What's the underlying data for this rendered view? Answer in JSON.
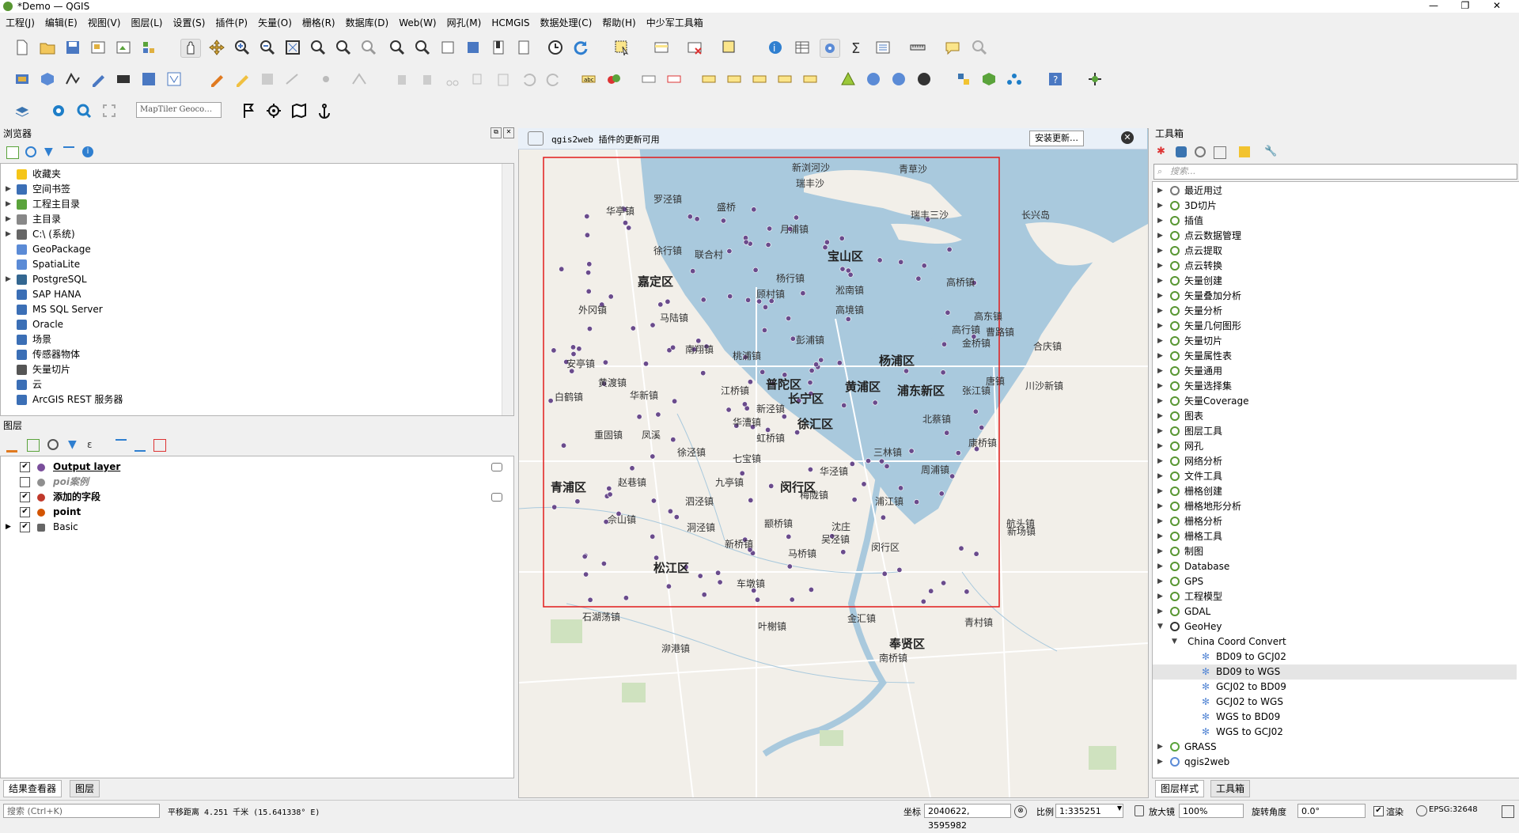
{
  "window": {
    "title": "*Demo — QGIS",
    "min": "—",
    "max": "❐",
    "close": "✕"
  },
  "menu": [
    "工程(J)",
    "编辑(E)",
    "视图(V)",
    "图层(L)",
    "设置(S)",
    "插件(P)",
    "矢量(O)",
    "栅格(R)",
    "数据库(D)",
    "Web(W)",
    "网孔(M)",
    "HCMGIS",
    "数据处理(C)",
    "帮助(H)",
    "中少军工具箱"
  ],
  "search_bar": {
    "geocoder_placeholder": "MapTiler Geoco…"
  },
  "browser": {
    "title": "浏览器",
    "items": [
      {
        "label": "收藏夹",
        "icon": "star-icon",
        "color": "#f5c518",
        "expandable": false
      },
      {
        "label": "空间书签",
        "icon": "bookmark-icon",
        "color": "#3b6fb6",
        "expandable": true
      },
      {
        "label": "工程主目录",
        "icon": "project-home-icon",
        "color": "#5aa33b",
        "expandable": true
      },
      {
        "label": "主目录",
        "icon": "home-icon",
        "color": "#888888",
        "expandable": true
      },
      {
        "label": "C:\\ (系统)",
        "icon": "drive-icon",
        "color": "#666666",
        "expandable": true
      },
      {
        "label": "GeoPackage",
        "icon": "geopackage-icon",
        "color": "#5b8bd6",
        "expandable": false
      },
      {
        "label": "SpatiaLite",
        "icon": "spatialite-icon",
        "color": "#5b8bd6",
        "expandable": false
      },
      {
        "label": "PostgreSQL",
        "icon": "postgresql-icon",
        "color": "#336791",
        "expandable": true
      },
      {
        "label": "SAP HANA",
        "icon": "sap-hana-icon",
        "color": "#3b6fb6",
        "expandable": false
      },
      {
        "label": "MS SQL Server",
        "icon": "mssql-icon",
        "color": "#3b6fb6",
        "expandable": false
      },
      {
        "label": "Oracle",
        "icon": "oracle-icon",
        "color": "#3b6fb6",
        "expandable": false
      },
      {
        "label": "场景",
        "icon": "scene-icon",
        "color": "#3b6fb6",
        "expandable": false
      },
      {
        "label": "传感器物体",
        "icon": "sensor-icon",
        "color": "#3b6fb6",
        "expandable": false
      },
      {
        "label": "矢量切片",
        "icon": "vector-tiles-icon",
        "color": "#555555",
        "expandable": false
      },
      {
        "label": "云",
        "icon": "cloud-icon",
        "color": "#3b6fb6",
        "expandable": false
      },
      {
        "label": "ArcGIS REST 服务器",
        "icon": "arcgis-icon",
        "color": "#3b6fb6",
        "expandable": false
      }
    ]
  },
  "layers": {
    "title": "图层",
    "items": [
      {
        "label": "Output layer",
        "checked": true,
        "bold": true,
        "underline": true,
        "italic": false,
        "color": "#7a4e9b"
      },
      {
        "label": "poi案例",
        "checked": false,
        "bold": true,
        "underline": false,
        "italic": true,
        "color": "#8f8f8f"
      },
      {
        "label": "添加的字段",
        "checked": true,
        "bold": true,
        "underline": false,
        "italic": false,
        "color": "#c0392b"
      },
      {
        "label": "point",
        "checked": true,
        "bold": true,
        "underline": false,
        "italic": false,
        "color": "#d35400"
      },
      {
        "label": "Basic",
        "checked": true,
        "bold": false,
        "underline": false,
        "italic": false,
        "color": "#666666"
      }
    ]
  },
  "notice": {
    "text": "qgis2web 插件的更新可用",
    "button": "安装更新…"
  },
  "map": {
    "labels": [
      {
        "t": "罗泾镇"
      },
      {
        "t": "盛桥"
      },
      {
        "t": "月浦镇"
      },
      {
        "t": "宝山区",
        "d": true
      },
      {
        "t": "华亭镇"
      },
      {
        "t": "徐行镇"
      },
      {
        "t": "联合村"
      },
      {
        "t": "嘉定区",
        "d": true
      },
      {
        "t": "杨行镇"
      },
      {
        "t": "顾村镇"
      },
      {
        "t": "淞南镇"
      },
      {
        "t": "高境镇"
      },
      {
        "t": "外冈镇"
      },
      {
        "t": "马陆镇"
      },
      {
        "t": "南翔镇"
      },
      {
        "t": "桃浦镇"
      },
      {
        "t": "彭浦镇"
      },
      {
        "t": "杨浦区",
        "d": true
      },
      {
        "t": "普陀区",
        "d": true
      },
      {
        "t": "黄浦区",
        "d": true
      },
      {
        "t": "浦东新区",
        "d": true
      },
      {
        "t": "长宁区",
        "d": true
      },
      {
        "t": "徐汇区",
        "d": true
      },
      {
        "t": "安亭镇"
      },
      {
        "t": "黄渡镇"
      },
      {
        "t": "江桥镇"
      },
      {
        "t": "华新镇"
      },
      {
        "t": "白鹤镇"
      },
      {
        "t": "华漕镇"
      },
      {
        "t": "新泾镇"
      },
      {
        "t": "虹桥镇"
      },
      {
        "t": "北蔡镇"
      },
      {
        "t": "张江镇"
      },
      {
        "t": "唐镇"
      },
      {
        "t": "重固镇"
      },
      {
        "t": "凤溪"
      },
      {
        "t": "徐泾镇"
      },
      {
        "t": "七宝镇"
      },
      {
        "t": "梅陇镇"
      },
      {
        "t": "三林镇"
      },
      {
        "t": "康桥镇"
      },
      {
        "t": "周浦镇"
      },
      {
        "t": "青浦区",
        "d": true
      },
      {
        "t": "赵巷镇"
      },
      {
        "t": "九亭镇"
      },
      {
        "t": "闵行区",
        "d": true
      },
      {
        "t": "华泾镇"
      },
      {
        "t": "泗泾镇"
      },
      {
        "t": "颛桥镇"
      },
      {
        "t": "沈庄"
      },
      {
        "t": "洞泾镇"
      },
      {
        "t": "新桥镇"
      },
      {
        "t": "浦江镇"
      },
      {
        "t": "吴泾镇"
      },
      {
        "t": "松江区",
        "d": true
      },
      {
        "t": "车墩镇"
      },
      {
        "t": "马桥镇"
      },
      {
        "t": "闵行区"
      },
      {
        "t": "奉贤区",
        "d": true
      },
      {
        "t": "南桥镇"
      },
      {
        "t": "青村镇"
      },
      {
        "t": "金汇镇"
      },
      {
        "t": "高桥镇"
      },
      {
        "t": "高东镇"
      },
      {
        "t": "高行镇"
      },
      {
        "t": "金桥镇"
      },
      {
        "t": "曹路镇"
      },
      {
        "t": "合庆镇"
      },
      {
        "t": "川沙新镇"
      },
      {
        "t": "新场镇"
      },
      {
        "t": "航头镇"
      },
      {
        "t": "瑞丰沙"
      },
      {
        "t": "瑞丰三沙"
      },
      {
        "t": "长兴岛"
      },
      {
        "t": "佘山镇"
      },
      {
        "t": "石湖荡镇"
      },
      {
        "t": "泖港镇"
      },
      {
        "t": "叶榭镇"
      },
      {
        "t": "新浏河沙"
      },
      {
        "t": "青草沙"
      }
    ]
  },
  "toolbox": {
    "title": "工具箱",
    "search_placeholder": "搜索...",
    "groups": [
      "最近用过",
      "3D切片",
      "插值",
      "点云数据管理",
      "点云提取",
      "点云转换",
      "矢量创建",
      "矢量叠加分析",
      "矢量分析",
      "矢量几何图形",
      "矢量切片",
      "矢量属性表",
      "矢量通用",
      "矢量选择集",
      "矢量Coverage",
      "图表",
      "图层工具",
      "网孔",
      "网络分析",
      "文件工具",
      "栅格创建",
      "栅格地形分析",
      "栅格分析",
      "栅格工具",
      "制图",
      "Database",
      "GPS",
      "工程模型",
      "GDAL"
    ],
    "geohey": {
      "label": "GeoHey",
      "sub": "China Coord Convert",
      "tools": [
        "BD09 to GCJ02",
        "BD09 to WGS",
        "GCJ02 to BD09",
        "GCJ02 to WGS",
        "WGS to BD09",
        "WGS to GCJ02"
      ],
      "selected_index": 1
    },
    "after": [
      "GRASS",
      "qgis2web"
    ],
    "bottom_tabs": [
      "图层样式",
      "工具箱"
    ]
  },
  "left_bottom_tabs": [
    "结果查看器",
    "图层"
  ],
  "status": {
    "search_placeholder": "搜索 (Ctrl+K)",
    "measure_text": "平移距离 4.251 千米 (15.641338° E)",
    "coord_label": "坐标",
    "coord_value": "2040622, 3595982",
    "scale_label": "比例",
    "scale_value": "1:335251",
    "magnifier_label": "放大镜",
    "magnifier_value": "100%",
    "rotation_label": "旋转角度",
    "rotation_value": "0.0°",
    "render_label": "渲染",
    "crs": "EPSG:32648"
  },
  "colors": {
    "water": "#a9c9dd",
    "land": "#f2efe9",
    "point": "#6a4b8c",
    "frame": "#e21b1b",
    "green": "#cfe2bf"
  }
}
